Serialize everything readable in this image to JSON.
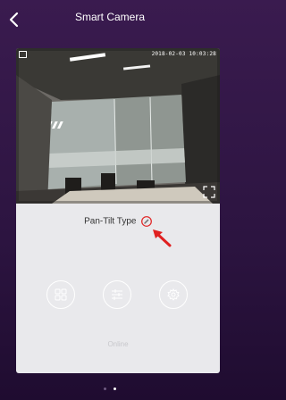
{
  "header": {
    "title": "Smart Camera"
  },
  "video": {
    "timestamp": "2018-02-03 10:03:28"
  },
  "device": {
    "ptz_label": "Pan-Tilt Type",
    "status": "Online"
  },
  "controls": [
    {
      "icon": "grid-icon"
    },
    {
      "icon": "sliders-icon"
    },
    {
      "icon": "gear-icon"
    }
  ],
  "pager": {
    "count": 2,
    "active": 1
  },
  "colors": {
    "background": "#2c1440",
    "card": "#e9e9ec",
    "arrow": "#e02020",
    "text": "#333333"
  }
}
